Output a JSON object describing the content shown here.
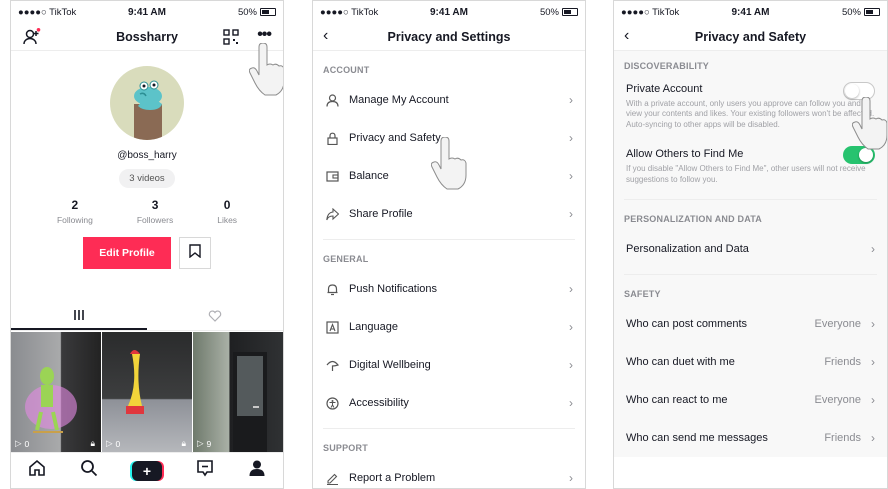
{
  "status": {
    "carrier": "●●●●○ TikTok",
    "time": "9:41 AM",
    "battery": "50%"
  },
  "profile": {
    "title": "Bossharry",
    "handle": "@boss_harry",
    "videos_pill": "3 videos",
    "stats": [
      {
        "num": "2",
        "label": "Following"
      },
      {
        "num": "3",
        "label": "Followers"
      },
      {
        "num": "0",
        "label": "Likes"
      }
    ],
    "edit_label": "Edit Profile",
    "videos": [
      {
        "views": "0",
        "locked": true
      },
      {
        "views": "0",
        "locked": true
      },
      {
        "views": "9",
        "locked": false
      }
    ],
    "accent": "#fe2c55"
  },
  "settings": {
    "title": "Privacy and Settings",
    "sections": [
      {
        "header": "ACCOUNT",
        "items": [
          {
            "label": "Manage My Account",
            "icon": "person-icon"
          },
          {
            "label": "Privacy and Safety",
            "icon": "lock-icon"
          },
          {
            "label": "Balance",
            "icon": "wallet-icon"
          },
          {
            "label": "Share Profile",
            "icon": "share-icon"
          }
        ]
      },
      {
        "header": "GENERAL",
        "items": [
          {
            "label": "Push Notifications",
            "icon": "bell-icon"
          },
          {
            "label": "Language",
            "icon": "language-icon"
          },
          {
            "label": "Digital Wellbeing",
            "icon": "wellbeing-icon"
          },
          {
            "label": "Accessibility",
            "icon": "accessibility-icon"
          }
        ]
      },
      {
        "header": "SUPPORT",
        "items": [
          {
            "label": "Report a Problem",
            "icon": "pencil-icon"
          }
        ]
      }
    ]
  },
  "privacy": {
    "title": "Privacy and Safety",
    "discoverability_header": "DISCOVERABILITY",
    "private_account": {
      "label": "Private Account",
      "desc": "With a private account, only users you approve can follow you and view your contents and likes. Your existing followers won't be affected. Auto-syncing to other apps will be disabled.",
      "on": false
    },
    "find_me": {
      "label": "Allow Others to Find Me",
      "desc": "If you disable \"Allow Others to Find Me\", other users will not receive suggestions to follow you.",
      "on": true
    },
    "personalization_header": "PERSONALIZATION AND DATA",
    "personalization_item": "Personalization and Data",
    "safety_header": "SAFETY",
    "safety_items": [
      {
        "label": "Who can post comments",
        "value": "Everyone"
      },
      {
        "label": "Who can duet with me",
        "value": "Friends"
      },
      {
        "label": "Who can react to me",
        "value": "Everyone"
      },
      {
        "label": "Who can send me messages",
        "value": "Friends"
      }
    ],
    "toggle_on_color": "#27c36f"
  }
}
